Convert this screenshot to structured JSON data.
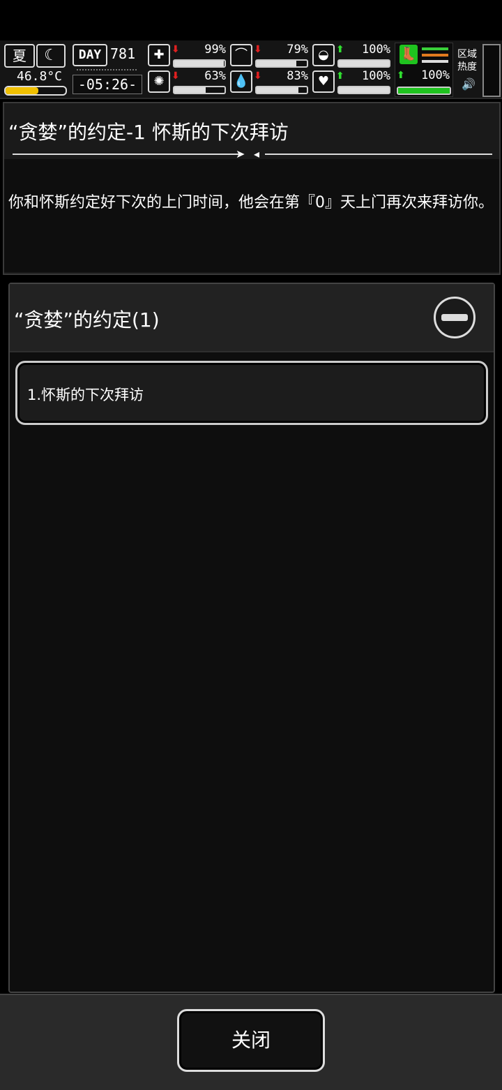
{
  "hud": {
    "season": "夏",
    "moon_icon": "moon-icon",
    "temperature": "46.8°C",
    "temperature_level": 0.55,
    "day_badge": "DAY",
    "day_number": "781",
    "clock": "-05:26-",
    "stats": [
      {
        "icon": "medkit-icon",
        "glyph": "✚",
        "trend": "down",
        "arrow": "⬇",
        "value": "99%",
        "level": 0.99
      },
      {
        "icon": "stomach-icon",
        "glyph": "⌒",
        "trend": "down",
        "arrow": "⬇",
        "value": "79%",
        "level": 0.79
      },
      {
        "icon": "pill-icon",
        "glyph": "◒",
        "trend": "up",
        "arrow": "⬆",
        "value": "100%",
        "level": 1.0
      },
      {
        "icon": "brain-icon",
        "glyph": "✺",
        "trend": "down",
        "arrow": "⬇",
        "value": "63%",
        "level": 0.63
      },
      {
        "icon": "water-drop-icon",
        "glyph": "💧",
        "trend": "down",
        "arrow": "⬇",
        "value": "83%",
        "level": 0.83
      },
      {
        "icon": "heart-icon",
        "glyph": "♥",
        "trend": "up",
        "arrow": "⬆",
        "value": "100%",
        "level": 1.0
      }
    ],
    "speed": {
      "icon": "boot-icon",
      "arrow": "⬆",
      "value": "100%",
      "level": 1.0
    },
    "heat_label": "区域热度",
    "speaker_glyph": "🔊"
  },
  "colors": {
    "accent_green": "#1fc31f",
    "alert_red": "#e02020",
    "line_green": "#3ad03a",
    "line_orange": "#e07a1e",
    "line_white": "#dddddd"
  },
  "detail": {
    "title": "“贪婪”的约定-1 怀斯的下次拜访",
    "text": "你和怀斯约定好下次的上门时间，他会在第『0』天上门再次来拜访你。"
  },
  "quest_group": {
    "title": "“贪婪”的约定(1)",
    "items": [
      {
        "label": "1.怀斯的下次拜访"
      }
    ]
  },
  "footer": {
    "close_label": "关闭"
  }
}
